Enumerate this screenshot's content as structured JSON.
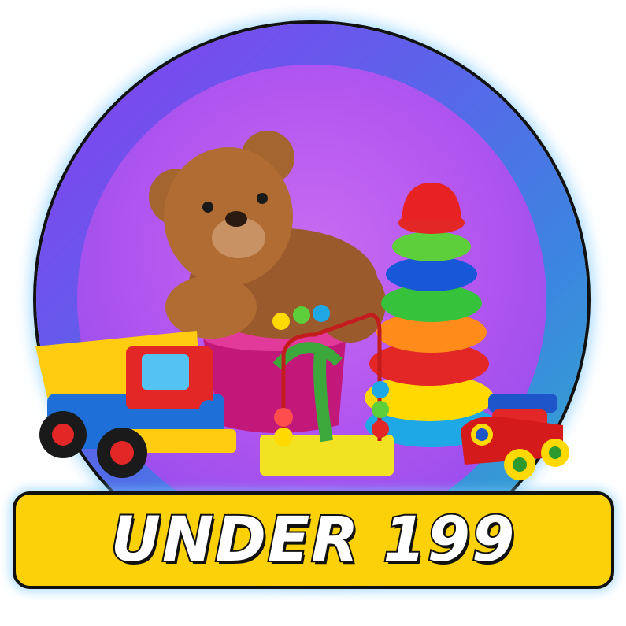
{
  "banner": {
    "label": "UNDER 199"
  },
  "colors": {
    "banner_bg": "#fdd108",
    "ring_outer": "#5b63ea",
    "ring_inner": "#b356f0",
    "outline": "#111111"
  },
  "illustration": {
    "items": [
      "teddy-bear-icon",
      "stacking-rings-toy-icon",
      "dump-truck-toy-icon",
      "bead-maze-toy-icon",
      "toy-car-icon",
      "toy-bucket-icon"
    ]
  }
}
